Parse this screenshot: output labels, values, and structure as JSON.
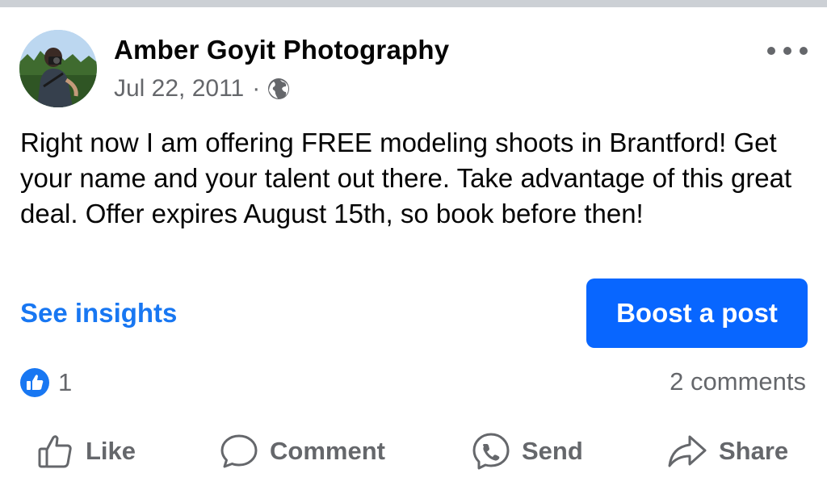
{
  "post": {
    "author": "Amber Goyit Photography",
    "date": "Jul 22, 2011",
    "separator": "·",
    "visibility_icon": "globe-icon",
    "text": "Right now I am offering FREE modeling shoots in Brantford! Get your name and your talent out there. Take advantage of this great deal. Offer expires August 15th, so book before then!",
    "insights_label": "See insights",
    "boost_label": "Boost a post",
    "like_count": "1",
    "comments_label": "2 comments"
  },
  "actions": [
    {
      "label": "Like",
      "icon": "thumbs-up-icon"
    },
    {
      "label": "Comment",
      "icon": "comment-bubble-icon"
    },
    {
      "label": "Send",
      "icon": "messenger-icon"
    },
    {
      "label": "Share",
      "icon": "share-arrow-icon"
    }
  ],
  "colors": {
    "accent": "#1877f2",
    "boost_button": "#0866ff",
    "secondary_text": "#65676b",
    "divider": "#ccd0d5"
  }
}
